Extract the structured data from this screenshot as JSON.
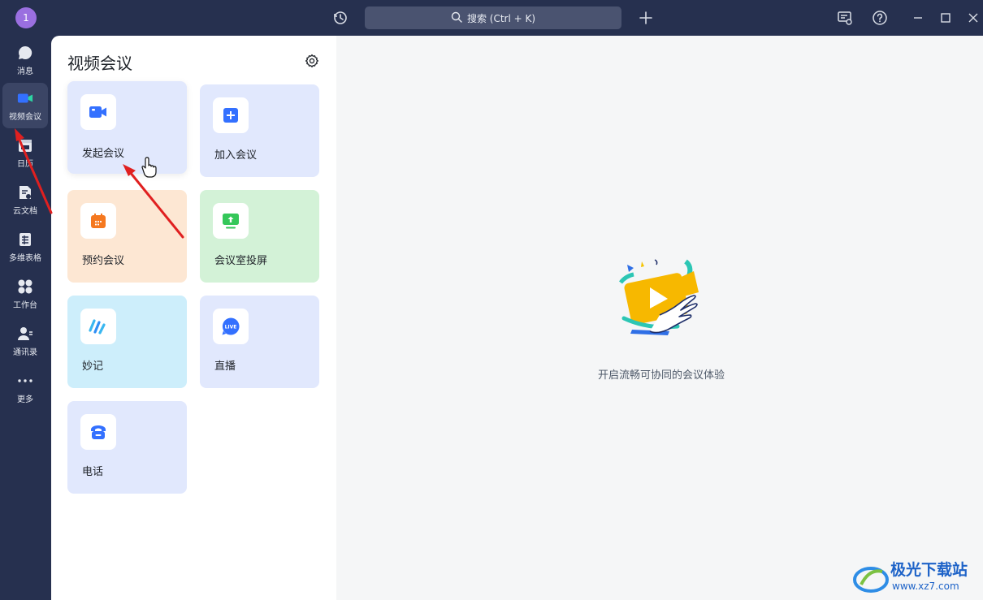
{
  "titlebar": {
    "avatar_text": "1",
    "search_placeholder": "搜索 (Ctrl + K)"
  },
  "sidebar": {
    "items": [
      {
        "label": "消息",
        "icon": "chat-bubble-icon"
      },
      {
        "label": "视频会议",
        "icon": "video-camera-icon",
        "active": true
      },
      {
        "label": "日历",
        "icon": "calendar-icon"
      },
      {
        "label": "云文档",
        "icon": "cloud-doc-icon"
      },
      {
        "label": "多维表格",
        "icon": "table-icon"
      },
      {
        "label": "工作台",
        "icon": "apps-grid-icon"
      },
      {
        "label": "通讯录",
        "icon": "contacts-icon"
      },
      {
        "label": "更多",
        "icon": "more-dots-icon"
      }
    ]
  },
  "panel": {
    "title": "视频会议",
    "cards": [
      {
        "label": "发起会议",
        "icon": "video-camera-icon",
        "color": "#e1e8fd"
      },
      {
        "label": "加入会议",
        "icon": "plus-square-icon",
        "color": "#e1e8fd"
      },
      {
        "label": "预约会议",
        "icon": "calendar-icon",
        "color": "#fde7d3"
      },
      {
        "label": "会议室投屏",
        "icon": "screen-share-icon",
        "color": "#d3f2d7"
      },
      {
        "label": "妙记",
        "icon": "minutes-icon",
        "color": "#cdeefb"
      },
      {
        "label": "直播",
        "icon": "live-icon",
        "color": "#e1e8fd"
      },
      {
        "label": "电话",
        "icon": "phone-icon",
        "color": "#e1e8fd"
      }
    ]
  },
  "main": {
    "empty_text": "开启流畅可协同的会议体验"
  },
  "watermark": {
    "line1": "极光下载站",
    "line2": "www.xz7.com"
  },
  "colors": {
    "sidebar_bg": "#26304f",
    "accent_blue": "#3370ff",
    "orange": "#f5781f",
    "green": "#34c759"
  }
}
